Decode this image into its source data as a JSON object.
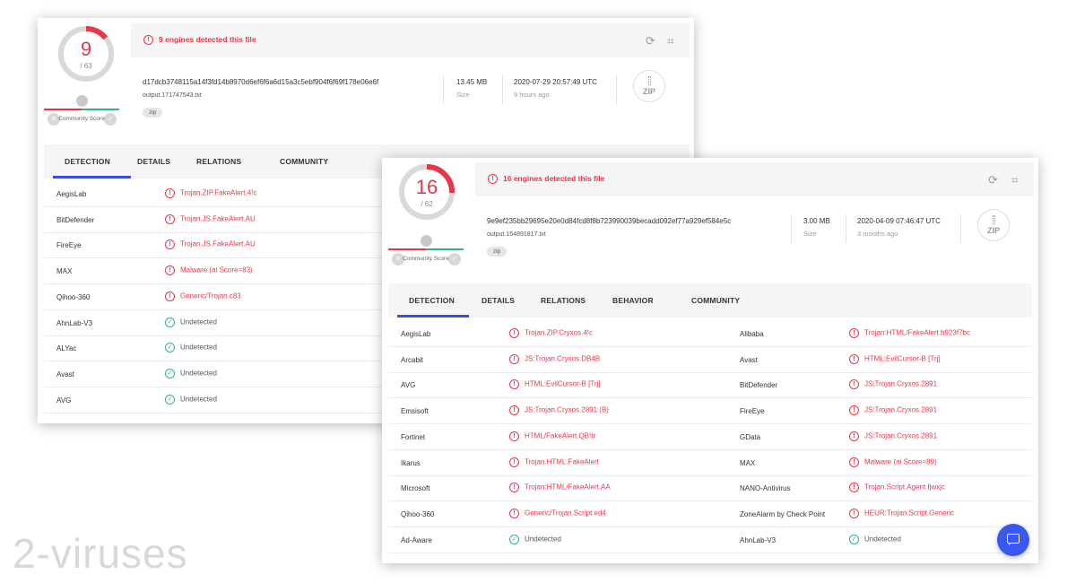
{
  "card1": {
    "score": "9",
    "total": "/ 63",
    "detected_msg": "9 engines detected this file",
    "community_label": "Community Score",
    "hash": "d17dcb3748115a14f3fd14b8970d6ef6f6a6d15a3c5ebf904f6f69f178e06e6f",
    "filename": "output.171747543.txt",
    "tag": "zip",
    "size": "13.45 MB",
    "size_label": "Size",
    "date": "2020-07-29 20:57:49 UTC",
    "date_ago": "9 hours ago",
    "file_type": "ZIP",
    "tabs": [
      "DETECTION",
      "DETAILS",
      "RELATIONS",
      "COMMUNITY"
    ],
    "rows": [
      {
        "engine": "AegisLab",
        "result": "Trojan.ZIP.FakeAlert.4!c",
        "status": "malicious"
      },
      {
        "engine": "BitDefender",
        "result": "Trojan.JS.FakeAlert.AU",
        "status": "malicious"
      },
      {
        "engine": "FireEye",
        "result": "Trojan.JS.FakeAlert.AU",
        "status": "malicious"
      },
      {
        "engine": "MAX",
        "result": "Malware (ai Score=83)",
        "status": "malicious"
      },
      {
        "engine": "Qihoo-360",
        "result": "Generic/Trojan.c83",
        "status": "malicious"
      },
      {
        "engine": "AhnLab-V3",
        "result": "Undetected",
        "status": "clean"
      },
      {
        "engine": "ALYac",
        "result": "Undetected",
        "status": "clean"
      },
      {
        "engine": "Avast",
        "result": "Undetected",
        "status": "clean"
      },
      {
        "engine": "AVG",
        "result": "Undetected",
        "status": "clean"
      }
    ]
  },
  "card2": {
    "score": "16",
    "total": "/ 62",
    "detected_msg": "16 engines detected this file",
    "community_label": "Community Score",
    "hash": "9e9ef235bb29695e20e0d84fcd8f8b723990039becadd092ef77a929ef584e5c",
    "filename": "output.154891817.txt",
    "tag": "zip",
    "size": "3.00 MB",
    "size_label": "Size",
    "date": "2020-04-09 07:46:47 UTC",
    "date_ago": "3 months ago",
    "file_type": "ZIP",
    "tabs": [
      "DETECTION",
      "DETAILS",
      "RELATIONS",
      "BEHAVIOR",
      "COMMUNITY"
    ],
    "rows": [
      {
        "engine": "AegisLab",
        "result": "Trojan.ZIP.Cryxos.4!c",
        "status": "malicious",
        "engine2": "Alibaba",
        "result2": "Trojan:HTML/FakeAlert.b923f7bc",
        "status2": "malicious"
      },
      {
        "engine": "Arcabit",
        "result": "JS:Trojan.Cryxos.DB4B",
        "status": "malicious",
        "engine2": "Avast",
        "result2": "HTML:EvilCursor-B [Trj]",
        "status2": "malicious"
      },
      {
        "engine": "AVG",
        "result": "HTML:EvilCursor-B [Trj]",
        "status": "malicious",
        "engine2": "BitDefender",
        "result2": "JS:Trojan.Cryxos.2891",
        "status2": "malicious"
      },
      {
        "engine": "Emsisoft",
        "result": "JS:Trojan.Cryxos.2891 (B)",
        "status": "malicious",
        "engine2": "FireEye",
        "result2": "JS:Trojan.Cryxos.2891",
        "status2": "malicious"
      },
      {
        "engine": "Fortinet",
        "result": "HTML/FakeAlert.QB!tr",
        "status": "malicious",
        "engine2": "GData",
        "result2": "JS:Trojan.Cryxos.2891",
        "status2": "malicious"
      },
      {
        "engine": "Ikarus",
        "result": "Trojan.HTML.FakeAlert",
        "status": "malicious",
        "engine2": "MAX",
        "result2": "Malware (ai Score=89)",
        "status2": "malicious"
      },
      {
        "engine": "Microsoft",
        "result": "Trojan:HTML/FakeAlert.AA",
        "status": "malicious",
        "engine2": "NANO-Antivirus",
        "result2": "Trojan.Script.Agent.fjwxjc",
        "status2": "malicious"
      },
      {
        "engine": "Qihoo-360",
        "result": "Generic/Trojan.Script.ed4",
        "status": "malicious",
        "engine2": "ZoneAlarm by Check Point",
        "result2": "HEUR:Trojan.Script.Generic",
        "status2": "malicious"
      },
      {
        "engine": "Ad-Aware",
        "result": "Undetected",
        "status": "clean",
        "engine2": "AhnLab-V3",
        "result2": "Undetected",
        "status2": "clean"
      }
    ]
  },
  "watermark": "2-viruses",
  "colors": {
    "malicious": "#e8374a",
    "clean": "#36b37e",
    "accent": "#3a4fe0"
  }
}
